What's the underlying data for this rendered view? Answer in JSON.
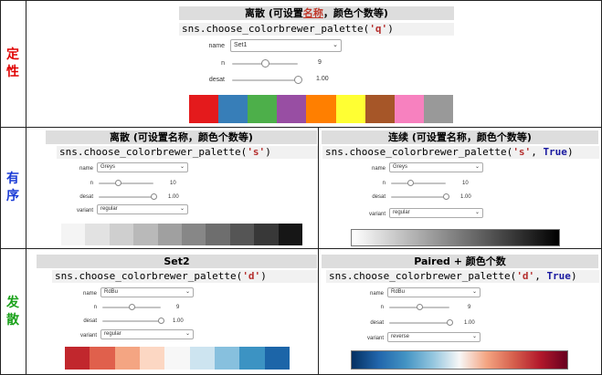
{
  "side_labels": {
    "qualitative": [
      "定",
      "性"
    ],
    "sequential": [
      "有",
      "序"
    ],
    "diverging": [
      "发",
      "散"
    ]
  },
  "side_colors": {
    "qualitative": "#e00000",
    "sequential": "#1a3bd6",
    "diverging": "#1aa11a"
  },
  "qual": {
    "title_a": "离散 (可设置",
    "title_link": "名称",
    "title_b": "，颜色个数等)",
    "code_pre": "sns.choose_colorbrewer_palette(",
    "code_arg": "'q'",
    "code_post": ")",
    "name_label": "name",
    "name_value": "Set1",
    "n_label": "n",
    "n_value": "9",
    "n_fraction": 0.5,
    "desat_label": "desat",
    "desat_value": "1.00",
    "desat_fraction": 1.0,
    "colors": [
      "#e41a1c",
      "#377eb8",
      "#4daf4a",
      "#984ea3",
      "#ff7f00",
      "#ffff33",
      "#a65628",
      "#f781bf",
      "#999999"
    ]
  },
  "seq_discrete": {
    "title": "离散 (可设置名称，颜色个数等)",
    "code_pre": "sns.choose_colorbrewer_palette(",
    "code_arg": "'s'",
    "code_post": ")",
    "name_label": "name",
    "name_value": "Greys",
    "n_label": "n",
    "n_value": "10",
    "n_fraction": 0.35,
    "desat_label": "desat",
    "desat_value": "1.00",
    "desat_fraction": 1.0,
    "variant_label": "variant",
    "variant_value": "regular",
    "colors": [
      "#f4f4f4",
      "#e2e2e2",
      "#cfcfcf",
      "#b9b9b9",
      "#a0a0a0",
      "#878787",
      "#6e6e6e",
      "#555555",
      "#383838",
      "#161616"
    ]
  },
  "seq_continuous": {
    "title": "连续 (可设置名称，颜色个数等)",
    "code_pre": "sns.choose_colorbrewer_palette(",
    "code_arg": "'s'",
    "code_sep": ", ",
    "code_kw": "True",
    "code_post": ")",
    "name_label": "name",
    "name_value": "Greys",
    "n_label": "n",
    "n_value": "10",
    "n_fraction": 0.35,
    "desat_label": "desat",
    "desat_value": "1.00",
    "desat_fraction": 1.0,
    "variant_label": "variant",
    "variant_value": "regular",
    "gradient": [
      "#ffffff",
      "#000000"
    ]
  },
  "div_discrete": {
    "title": "Set2",
    "code_pre": "sns.choose_colorbrewer_palette(",
    "code_arg": "'d'",
    "code_post": ")",
    "name_label": "name",
    "name_value": "RdBu",
    "n_label": "n",
    "n_value": "9",
    "n_fraction": 0.5,
    "desat_label": "desat",
    "desat_value": "1.00",
    "desat_fraction": 1.0,
    "variant_label": "variant",
    "variant_value": "regular",
    "colors": [
      "#c1272d",
      "#e0604c",
      "#f4a582",
      "#fcd7c3",
      "#f7f7f7",
      "#cde4f0",
      "#87c0de",
      "#3c93c3",
      "#1c65a8"
    ]
  },
  "div_continuous": {
    "title": "Paired + 颜色个数",
    "code_pre": "sns.choose_colorbrewer_palette(",
    "code_arg": "'d'",
    "code_sep": ", ",
    "code_kw": "True",
    "code_post": ")",
    "name_label": "name",
    "name_value": "RdBu",
    "n_label": "n",
    "n_value": "9",
    "n_fraction": 0.5,
    "desat_label": "desat",
    "desat_value": "1.00",
    "desat_fraction": 1.0,
    "variant_label": "variant",
    "variant_value": "reverse",
    "gradient": [
      "#053061",
      "#2166ac",
      "#4393c3",
      "#92c5de",
      "#f7f7f7",
      "#f4a582",
      "#d6604d",
      "#b2182b",
      "#67001f"
    ]
  }
}
